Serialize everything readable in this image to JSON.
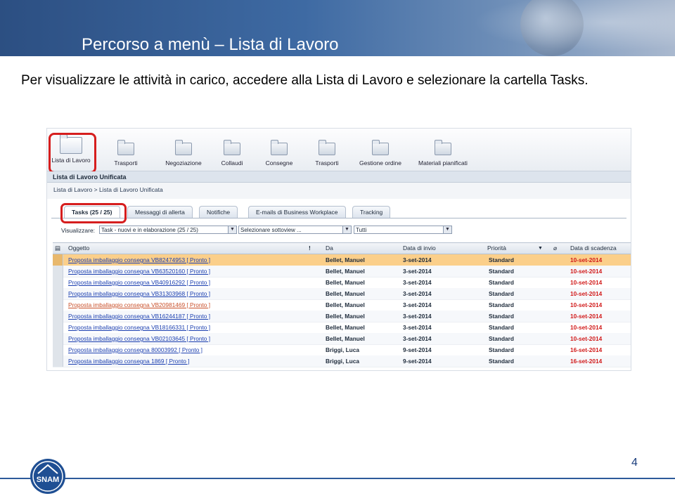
{
  "slide": {
    "title": "Percorso a menù  – Lista di Lavoro",
    "instruction": "Per visualizzare le attività in carico, accedere alla Lista di Lavoro e selezionare la cartella Tasks.",
    "page_number": "4"
  },
  "toolbar": {
    "items": [
      {
        "label": "Lista di Lavoro",
        "icon": "worklist-icon"
      },
      {
        "label": "Trasporti",
        "icon": "folder-icon"
      },
      {
        "label": "Negoziazione",
        "icon": "folder-icon"
      },
      {
        "label": "Collaudi",
        "icon": "folder-icon"
      },
      {
        "label": "Consegne",
        "icon": "folder-icon"
      },
      {
        "label": "Trasporti",
        "icon": "folder-icon"
      },
      {
        "label": "Gestione ordine",
        "icon": "folder-icon"
      },
      {
        "label": "Materiali pianificati",
        "icon": "folder-icon"
      }
    ]
  },
  "pane": {
    "title": "Lista di Lavoro Unificata",
    "breadcrumb": "Lista di Lavoro  >  Lista di Lavoro Unificata"
  },
  "tabs": [
    {
      "label": "Tasks  (25 / 25)"
    },
    {
      "label": "Messaggi di allerta"
    },
    {
      "label": "Notifiche"
    },
    {
      "label": "E-mails di Business Workplace"
    },
    {
      "label": "Tracking"
    }
  ],
  "filter": {
    "label": "Visualizzare:",
    "select1": "Task - nuovi e in elaborazione  (25 / 25)",
    "select2": "Selezionare sottoview ...",
    "select3": "Tutti"
  },
  "table": {
    "headers": {
      "subject": "Oggetto",
      "importance": "!",
      "from": "Da",
      "sent": "Data di invio",
      "priority": "Priorità",
      "due": "Data di scadenza"
    },
    "rows": [
      {
        "subject": "Proposta imballaggio consegna VB82474953 [ Pronto ]",
        "from": "Bellet, Manuel",
        "sent": "3-set-2014",
        "priority": "Standard",
        "due": "10-set-2014"
      },
      {
        "subject": "Proposta imballaggio consegna VB63520160 [ Pronto ]",
        "from": "Bellet, Manuel",
        "sent": "3-set-2014",
        "priority": "Standard",
        "due": "10-set-2014"
      },
      {
        "subject": "Proposta imballaggio consegna VB40916292 [ Pronto ]",
        "from": "Bellet, Manuel",
        "sent": "3-set-2014",
        "priority": "Standard",
        "due": "10-set-2014"
      },
      {
        "subject": "Proposta imballaggio consegna VB31303968 [ Pronto ]",
        "from": "Bellet, Manuel",
        "sent": "3-set-2014",
        "priority": "Standard",
        "due": "10-set-2014"
      },
      {
        "subject": "Proposta imballaggio consegna VB20981469 [ Pronto ]",
        "from": "Bellet, Manuel",
        "sent": "3-set-2014",
        "priority": "Standard",
        "due": "10-set-2014"
      },
      {
        "subject": "Proposta imballaggio consegna VB16244187 [ Pronto ]",
        "from": "Bellet, Manuel",
        "sent": "3-set-2014",
        "priority": "Standard",
        "due": "10-set-2014"
      },
      {
        "subject": "Proposta imballaggio consegna VB18166331 [ Pronto ]",
        "from": "Bellet, Manuel",
        "sent": "3-set-2014",
        "priority": "Standard",
        "due": "10-set-2014"
      },
      {
        "subject": "Proposta imballaggio consegna VB02103645 [ Pronto ]",
        "from": "Bellet, Manuel",
        "sent": "3-set-2014",
        "priority": "Standard",
        "due": "10-set-2014"
      },
      {
        "subject": "Proposta imballaggio consegna 80003992 [ Pronto ]",
        "from": "Briggi, Luca",
        "sent": "9-set-2014",
        "priority": "Standard",
        "due": "16-set-2014"
      },
      {
        "subject": "Proposta imballaggio consegna 1869 [ Pronto ]",
        "from": "Briggi, Luca",
        "sent": "9-set-2014",
        "priority": "Standard",
        "due": "16-set-2014"
      }
    ]
  },
  "logo": {
    "text": "SNAM"
  },
  "colors": {
    "highlight": "#d61e1e",
    "banner": "#2c4f82",
    "selected_row": "#fbcf8a",
    "due_date": "#d11a1a"
  }
}
